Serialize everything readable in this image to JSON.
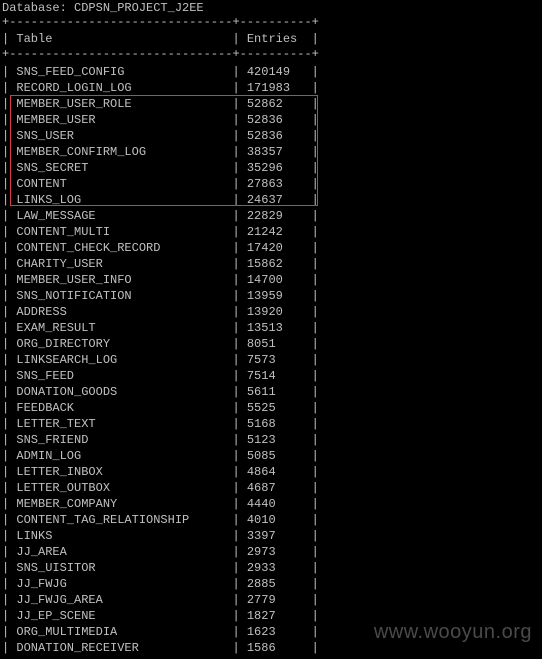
{
  "console": {
    "header_line": "Database: CDPSN_PROJECT_J2EE",
    "border_line": "+-------------------------------+----------+",
    "column_header_line": "| Table                         | Entries  |",
    "rows": [
      "| SNS_FEED_CONFIG               | 420149   |",
      "| RECORD_LOGIN_LOG              | 171983   |",
      "| MEMBER_USER_ROLE              | 52862    |",
      "| MEMBER_USER                   | 52836    |",
      "| SNS_USER                      | 52836    |",
      "| MEMBER_CONFIRM_LOG            | 38357    |",
      "| SNS_SECRET                    | 35296    |",
      "| CONTENT                       | 27863    |",
      "| LINKS_LOG                     | 24637    |",
      "| LAW_MESSAGE                   | 22829    |",
      "| CONTENT_MULTI                 | 21242    |",
      "| CONTENT_CHECK_RECORD          | 17420    |",
      "| CHARITY_USER                  | 15862    |",
      "| MEMBER_USER_INFO              | 14700    |",
      "| SNS_NOTIFICATION              | 13959    |",
      "| ADDRESS                       | 13920    |",
      "| EXAM_RESULT                   | 13513    |",
      "| ORG_DIRECTORY                 | 8051     |",
      "| LINKSEARCH_LOG                | 7573     |",
      "| SNS_FEED                      | 7514     |",
      "| DONATION_GOODS                | 5611     |",
      "| FEEDBACK                      | 5525     |",
      "| LETTER_TEXT                   | 5168     |",
      "| SNS_FRIEND                    | 5123     |",
      "| ADMIN_LOG                     | 5085     |",
      "| LETTER_INBOX                  | 4864     |",
      "| LETTER_OUTBOX                 | 4687     |",
      "| MEMBER_COMPANY                | 4440     |",
      "| CONTENT_TAG_RELATIONSHIP      | 4010     |",
      "| LINKS                         | 3397     |",
      "| JJ_AREA                       | 2973     |",
      "| SNS_UISITOR                   | 2933     |",
      "| JJ_FWJG                       | 2885     |",
      "| JJ_FWJG_AREA                  | 2779     |",
      "| JJ_EP_SCENE                   | 1827     |",
      "| ORG_MULTIMEDIA                | 1623     |",
      "| DONATION_RECEIVER             | 1586     |"
    ]
  },
  "watermark": "www.wooyun.org",
  "colors": {
    "background": "#000000",
    "text": "#c0c0c0",
    "highlight_border": "#d8384a",
    "watermark": "#4a4a4a"
  }
}
